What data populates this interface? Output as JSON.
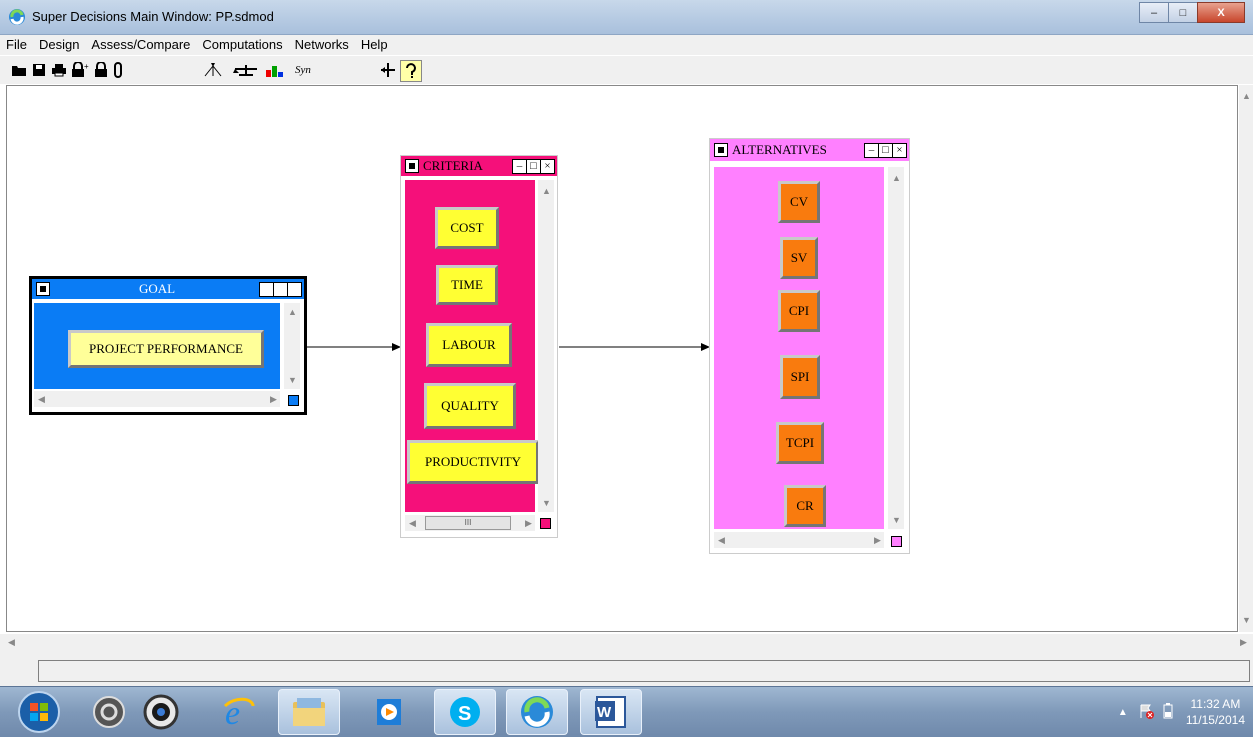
{
  "window": {
    "title": "Super Decisions Main Window: PP.sdmod",
    "min_glyph": "–",
    "max_glyph": "□",
    "close_glyph": "X"
  },
  "menu": [
    "File",
    "Design",
    "Assess/Compare",
    "Computations",
    "Networks",
    "Help"
  ],
  "toolbar": {
    "syn_label": "Syn"
  },
  "clusters": {
    "goal": {
      "name": "GOAL",
      "color": "#0a7cf5",
      "nodes": [
        "PROJECT PERFORMANCE"
      ]
    },
    "criteria": {
      "name": "CRITERIA",
      "color": "#f5107a",
      "nodes": [
        "COST",
        "TIME",
        "LABOUR",
        "QUALITY",
        "PRODUCTIVITY"
      ],
      "hscroll_thumb": "III"
    },
    "alternatives": {
      "name": "ALTERNATIVES",
      "color": "#ff80ff",
      "nodes": [
        "CV",
        "SV",
        "CPI",
        "SPI",
        "TCPI",
        "CR"
      ]
    }
  },
  "node_colors": {
    "criteria": "#ffff33",
    "alternatives": "#f97b0e",
    "goal": "#ffff99"
  },
  "taskbar": {
    "apps": [
      "start-orb",
      "app-gray-circle",
      "camera-app",
      "internet-explorer",
      "file-explorer",
      "media-player",
      "skype",
      "super-decisions",
      "word"
    ],
    "clock_time": "11:32 AM",
    "clock_date": "11/15/2014"
  }
}
